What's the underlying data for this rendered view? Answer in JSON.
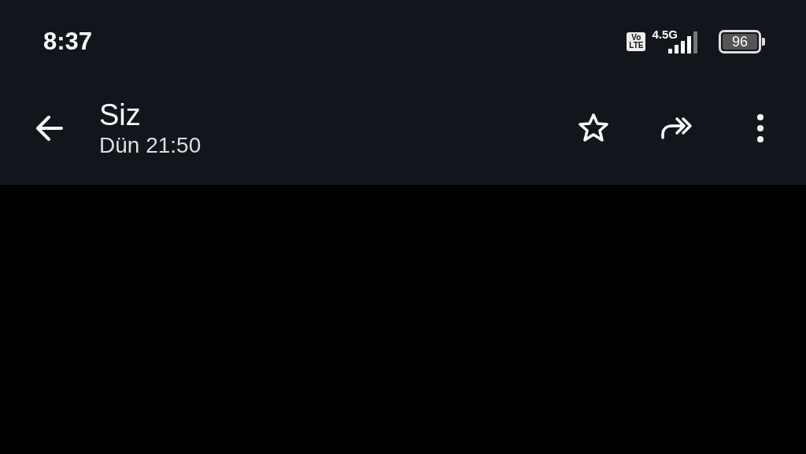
{
  "status_bar": {
    "time": "8:37",
    "volte_badge": [
      "Vo",
      "LTE"
    ],
    "network": "4.5G",
    "battery": "96"
  },
  "app_bar": {
    "title": "Siz",
    "subtitle": "Dün 21:50",
    "actions": [
      {
        "kind": "star"
      },
      {
        "kind": "forward"
      },
      {
        "kind": "more"
      }
    ]
  }
}
